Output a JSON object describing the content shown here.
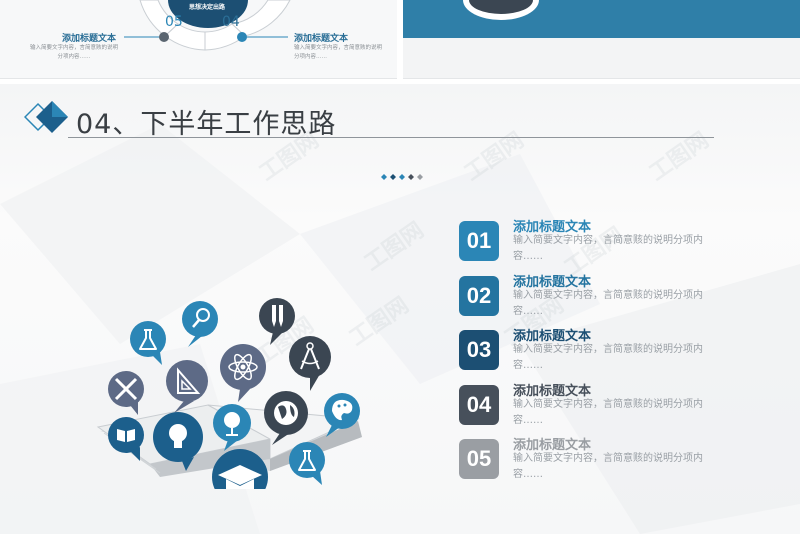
{
  "top_left": {
    "center_label": "思想决定出路",
    "num_left": "05",
    "num_right": "04",
    "left_item": {
      "title": "添加标题文本",
      "desc": "输入简要文字内容，言简意赅的说明分项内容……"
    },
    "right_item": {
      "title": "添加标题文本",
      "desc": "输入简要文字内容，言简意赅的说明分项内容……"
    }
  },
  "section": {
    "title": "04、下半年工作思路"
  },
  "watermark": "工图网",
  "items": [
    {
      "num": "01",
      "title": "添加标题文本",
      "desc": "输入简要文字内容，言简意赅的说明分项内容……",
      "color": "#2b86b6"
    },
    {
      "num": "02",
      "title": "添加标题文本",
      "desc": "输入简要文字内容，言简意赅的说明分项内容……",
      "color": "#2474a0"
    },
    {
      "num": "03",
      "title": "添加标题文本",
      "desc": "输入简要文字内容，言简意赅的说明分项内容……",
      "color": "#1c4f73"
    },
    {
      "num": "04",
      "title": "添加标题文本",
      "desc": "输入简要文字内容，言简意赅的说明分项内容……",
      "color": "#47505b"
    },
    {
      "num": "05",
      "title": "添加标题文本",
      "desc": "输入简要文字内容，言简意赅的说明分项内容……",
      "color": "#9a9ea3"
    }
  ],
  "icons": [
    "flask-icon",
    "magnifier-icon",
    "pens-icon",
    "compass-icon",
    "ruler-pencil-icon",
    "triangle-ruler-icon",
    "atom-icon",
    "globe-icon",
    "palette-icon",
    "book-icon",
    "lightbulb-icon",
    "desk-globe-icon",
    "graduation-cap-icon",
    "flask-icon"
  ],
  "colors": {
    "teal": "#2b86b6",
    "navy": "#1c4f73",
    "slate": "#47505b",
    "gray": "#9a9ea3"
  }
}
